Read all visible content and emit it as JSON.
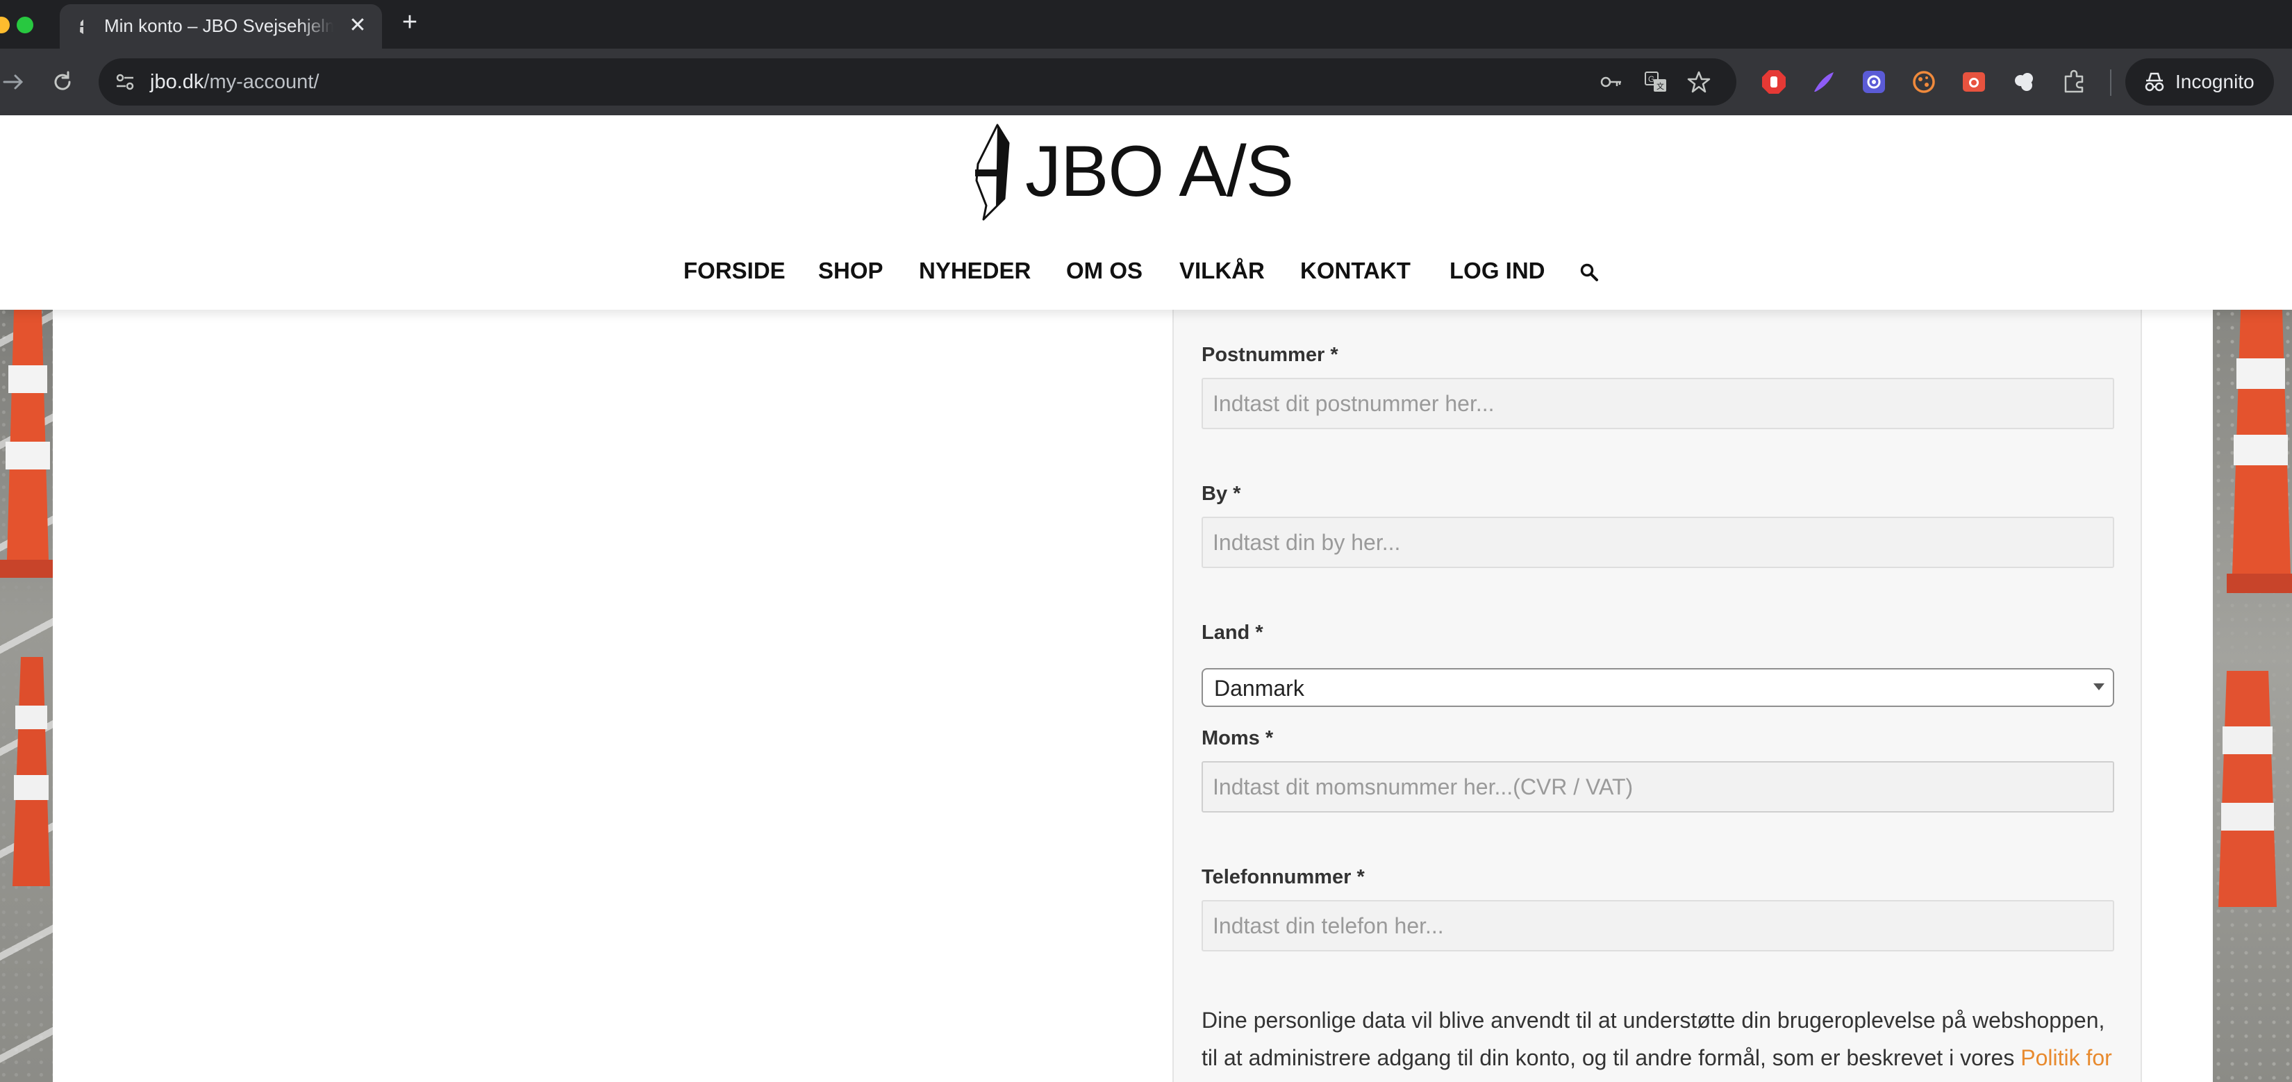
{
  "browser": {
    "tab_title": "Min konto – JBO Svejsehjelme",
    "tab_close": "✕",
    "new_tab": "+",
    "url_domain": "jbo.dk",
    "url_path": "/my-account/",
    "profile_label": "Incognito"
  },
  "site": {
    "logo_text": "JBO A/S",
    "nav": [
      {
        "label": "FORSIDE"
      },
      {
        "label": "SHOP"
      },
      {
        "label": "NYHEDER"
      },
      {
        "label": "OM OS"
      },
      {
        "label": "VILKÅR"
      },
      {
        "label": "KONTAKT"
      },
      {
        "label": "LOG IND"
      }
    ]
  },
  "form": {
    "required_mark": "*",
    "postnummer": {
      "label": "Postnummer",
      "placeholder": "Indtast dit postnummer her..."
    },
    "by": {
      "label": "By",
      "placeholder": "Indtast din by her..."
    },
    "land": {
      "label": "Land",
      "value": "Danmark"
    },
    "moms": {
      "label": "Moms",
      "placeholder": "Indtast dit momsnummer her...(CVR / VAT)"
    },
    "telefon": {
      "label": "Telefonnummer",
      "placeholder": "Indtast din telefon her..."
    },
    "privacy_text": "Dine personlige data vil blive anvendt til at understøtte din brugeroplevelse på webshoppen, til at administrere adgang til din konto, og til andre formål, som er beskrevet i vores ",
    "privacy_link": "Politik for"
  },
  "colors": {
    "link": "#e88a2e",
    "chrome_dark": "#202124",
    "chrome_toolbar": "#35363a"
  }
}
